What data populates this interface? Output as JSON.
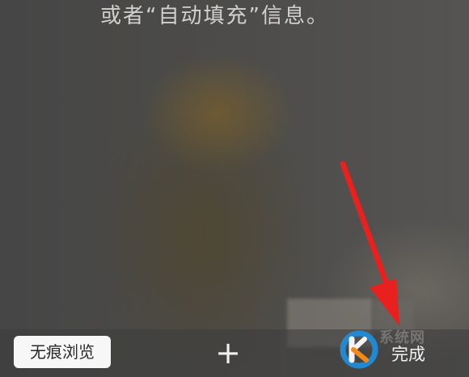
{
  "header": {
    "partial_text": "或者“自动填充”信息。"
  },
  "toolbar": {
    "incognito_label": "无痕浏览",
    "add_tab_label": "+",
    "done_label": "完成"
  },
  "watermark": {
    "text": "系统网"
  },
  "colors": {
    "arrow": "#e8201e",
    "incognito_bg": "#f7f7f7",
    "watermark_blue": "#1e8fe0"
  },
  "icons": {
    "watermark_logo": "k-logo-icon",
    "annotation": "red-arrow-icon"
  }
}
